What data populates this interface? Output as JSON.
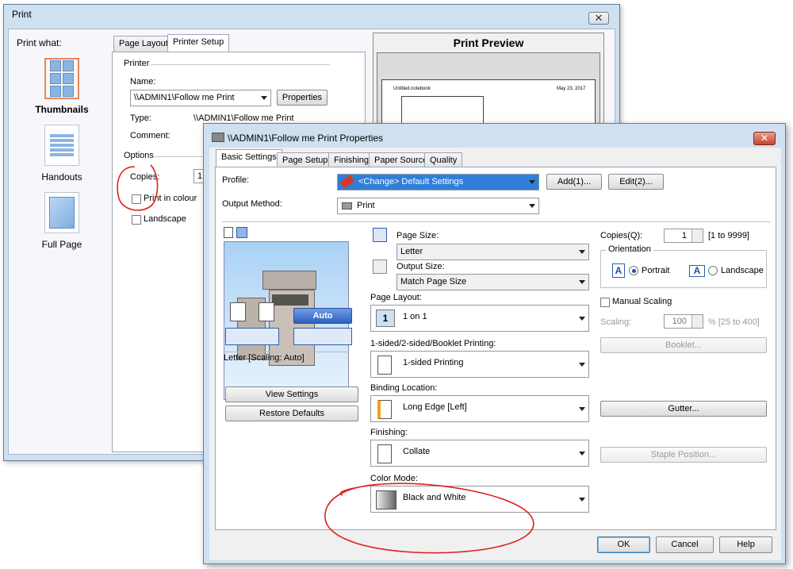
{
  "print_window": {
    "title": "Print",
    "close_label": "✕",
    "print_what_label": "Print what:",
    "options": [
      {
        "label": "Thumbnails"
      },
      {
        "label": "Handouts"
      },
      {
        "label": "Full Page"
      }
    ],
    "tabs": [
      "Page Layout",
      "Printer Setup"
    ],
    "printer_group": "Printer",
    "name_label": "Name:",
    "printer_name": "\\\\ADMIN1\\Follow me Print",
    "properties_button": "Properties",
    "type_label": "Type:",
    "type_value": "\\\\ADMIN1\\Follow me Print",
    "comment_label": "Comment:",
    "options_group": "Options",
    "copies_label": "Copies:",
    "copies_value": "1",
    "print_in_colour": "Print in colour",
    "landscape": "Landscape",
    "preview_title": "Print Preview",
    "preview_doc_name": "Untitled.notebook",
    "preview_date": "May 23, 2017"
  },
  "props_window": {
    "title": "\\\\ADMIN1\\Follow me Print Properties",
    "close_label": "✕",
    "tabs": [
      "Basic Settings",
      "Page Setup",
      "Finishing",
      "Paper Source",
      "Quality"
    ],
    "profile_label": "Profile:",
    "profile_value": "<Change> Default Settings",
    "add_button": "Add(1)...",
    "edit_button": "Edit(2)...",
    "output_method_label": "Output Method:",
    "output_method_value": "Print",
    "auto_button": "Auto",
    "preview_status": "Letter [Scaling: Auto]",
    "view_settings_button": "View Settings",
    "restore_defaults_button": "Restore Defaults",
    "page_size_label": "Page Size:",
    "page_size_value": "Letter",
    "output_size_label": "Output Size:",
    "output_size_value": "Match Page Size",
    "page_layout_label": "Page Layout:",
    "page_layout_icon_text": "1",
    "page_layout_value": "1 on 1",
    "sided_label": "1-sided/2-sided/Booklet Printing:",
    "sided_value": "1-sided Printing",
    "binding_label": "Binding Location:",
    "binding_value": "Long Edge [Left]",
    "finishing_label": "Finishing:",
    "finishing_value": "Collate",
    "color_mode_label": "Color Mode:",
    "color_mode_value": "Black and White",
    "copies_label": "Copies(Q):",
    "copies_value": "1",
    "copies_range": "[1 to 9999]",
    "orientation_label": "Orientation",
    "portrait_label": "Portrait",
    "landscape_label": "Landscape",
    "orientation_icon_text": "A",
    "manual_scaling_label": "Manual Scaling",
    "scaling_label": "Scaling:",
    "scaling_value": "100",
    "scaling_range": "% [25 to 400]",
    "booklet_button": "Booklet...",
    "gutter_button": "Gutter...",
    "staple_button": "Staple Position...",
    "ok_button": "OK",
    "cancel_button": "Cancel",
    "help_button": "Help"
  },
  "colors": {
    "annotation_red": "#e0201a",
    "window_frame": "#cfe0f0",
    "selection_blue": "#2f7fd8"
  }
}
